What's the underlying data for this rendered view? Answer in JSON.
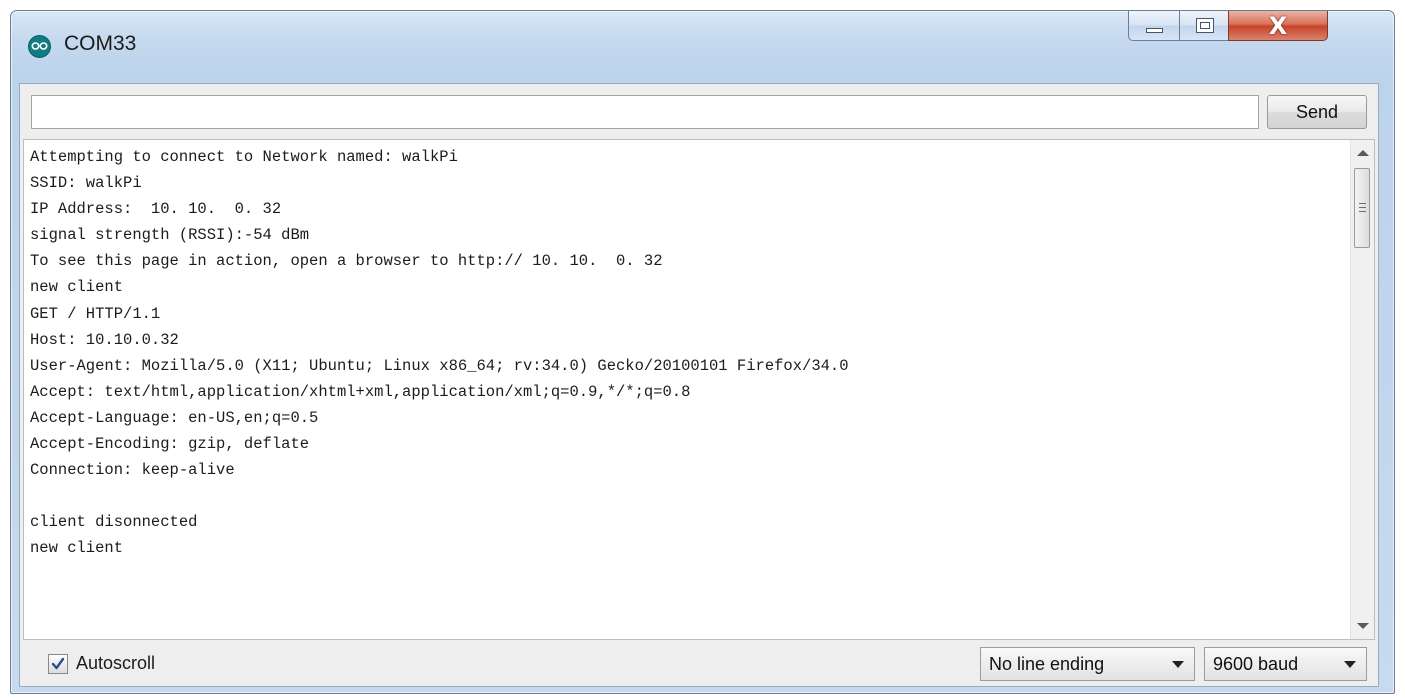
{
  "window": {
    "title": "COM33",
    "close_glyph": "X"
  },
  "input": {
    "value": "",
    "placeholder": ""
  },
  "send_button": {
    "label": "Send"
  },
  "output": {
    "lines": [
      "Attempting to connect to Network named: walkPi",
      "SSID: walkPi",
      "IP Address:  10. 10.  0. 32",
      "signal strength (RSSI):-54 dBm",
      "To see this page in action, open a browser to http:// 10. 10.  0. 32",
      "new client",
      "GET / HTTP/1.1",
      "Host: 10.10.0.32",
      "User-Agent: Mozilla/5.0 (X11; Ubuntu; Linux x86_64; rv:34.0) Gecko/20100101 Firefox/34.0",
      "Accept: text/html,application/xhtml+xml,application/xml;q=0.9,*/*;q=0.8",
      "Accept-Language: en-US,en;q=0.5",
      "Accept-Encoding: gzip, deflate",
      "Connection: keep-alive",
      "",
      "client disonnected",
      "new client"
    ]
  },
  "status": {
    "autoscroll_label": "Autoscroll",
    "autoscroll_checked": true,
    "line_ending": "No line ending",
    "baud": "9600 baud"
  },
  "colors": {
    "app_icon": "#0f7d83",
    "close_button": "#c7432a",
    "frame": "#c4d8ee"
  }
}
